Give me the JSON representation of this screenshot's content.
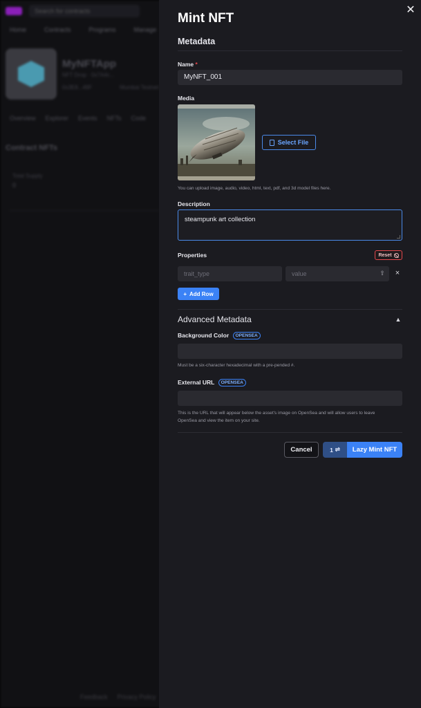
{
  "background": {
    "search_placeholder": "Search for contracts",
    "nav": [
      "Home",
      "Contracts",
      "Programs",
      "Manage"
    ],
    "app_name": "MyNFTApp",
    "app_meta": "NFT Drop · 0x7A4c...",
    "app_meta_items": [
      "0x3E8...49F",
      "Mumbai Testnet"
    ],
    "tabs": [
      "Overview",
      "Explorer",
      "Events",
      "NFTs",
      "Code"
    ],
    "section_title": "Contract NFTs",
    "stat_label": "Total Supply",
    "stat_value": "0",
    "footer": [
      "Feedback",
      "Privacy Policy"
    ]
  },
  "drawer": {
    "title": "Mint NFT",
    "section_heading": "Metadata",
    "close_icon": "close-icon",
    "name": {
      "label": "Name",
      "required_mark": "*",
      "value": "MyNFT_001"
    },
    "media": {
      "label": "Media",
      "select_file_label": "Select File",
      "help": "You can upload image, audio, video, html, text, pdf, and 3d model files here.",
      "image_subject": "steampunk-airship"
    },
    "description": {
      "label": "Description",
      "value": "steampunk art collection"
    },
    "properties": {
      "label": "Properties",
      "reset_label": "Reset",
      "trait_placeholder": "trait_type",
      "value_placeholder": "value",
      "remove_icon": "×",
      "add_row_label": "Add Row",
      "add_icon": "+"
    },
    "advanced": {
      "heading": "Advanced Metadata",
      "background_color": {
        "label": "Background Color",
        "badge": "OPENSEA",
        "help": "Must be a six-character hexadecimal with a pre-pended #."
      },
      "external_url": {
        "label": "External URL",
        "badge": "OPENSEA",
        "help_line1": "This is the URL that will appear below the asset's image on OpenSea and will allow users to leave",
        "help_line2": "OpenSea and view the item on your site."
      }
    },
    "footer": {
      "cancel_label": "Cancel",
      "count": "1",
      "count_icon": "⇌",
      "mint_label": "Lazy Mint NFT"
    }
  },
  "colors": {
    "accent": "#3b82f6",
    "danger": "#e5484d",
    "drawer_bg": "#1b1b20",
    "input_bg": "#2a2a30"
  }
}
